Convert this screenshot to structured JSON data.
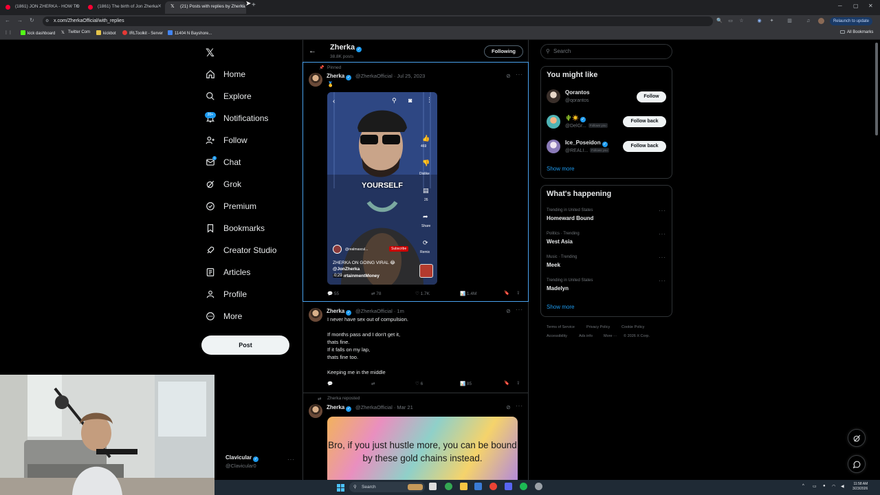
{
  "browser": {
    "tabs": [
      {
        "title": "(1861) JON ZHERKA - HOW TO",
        "favicon": "youtube-icon",
        "active": false
      },
      {
        "title": "(1861) The birth of Jon Zherka",
        "favicon": "youtube-icon",
        "active": false
      },
      {
        "title": "(21) Posts with replies by Zherka",
        "favicon": "x-icon",
        "active": true
      }
    ],
    "new_tab": "+",
    "url": "x.com/ZherkaOfficial/with_replies",
    "relaunch_label": "Relaunch to update",
    "bookmarks": [
      "kick dashboard",
      "Twitter Com",
      "kickbot",
      "IRLToolkit - Server",
      "11404 N Bayshore..."
    ],
    "all_bookmarks": "All Bookmarks"
  },
  "nav": {
    "items": [
      {
        "label": "Home",
        "icon": "home-icon"
      },
      {
        "label": "Explore",
        "icon": "search-icon"
      },
      {
        "label": "Notifications",
        "icon": "bell-icon"
      },
      {
        "label": "Follow",
        "icon": "person-plus-icon"
      },
      {
        "label": "Chat",
        "icon": "mail-icon"
      },
      {
        "label": "Grok",
        "icon": "grok-icon"
      },
      {
        "label": "Premium",
        "icon": "verified-icon"
      },
      {
        "label": "Bookmarks",
        "icon": "bookmark-icon"
      },
      {
        "label": "Creator Studio",
        "icon": "rocket-icon"
      },
      {
        "label": "Articles",
        "icon": "article-icon"
      },
      {
        "label": "Profile",
        "icon": "person-icon"
      },
      {
        "label": "More",
        "icon": "more-circle-icon"
      }
    ],
    "notifications_badge": "20+",
    "chat_badge": "1",
    "post_button": "Post",
    "account": {
      "name": "Clavicular",
      "handle": "@Clavicular0"
    }
  },
  "profile_header": {
    "name": "Zherka",
    "posts_count": "38.8K posts",
    "following_button": "Following"
  },
  "posts": [
    {
      "label": "Pinned",
      "name": "Zherka",
      "handle": "@ZherkaOfficial",
      "date": "· Jul 25, 2023",
      "text": "🥇",
      "video": {
        "caption_big": "YOURSELF",
        "channel": "@realmascul...",
        "subscribe": "Subscribe",
        "title_line1": "ZHERKA ON GOING VIRAL 😂",
        "title_line2": "@JonZherka",
        "title_line3": "#EntertainmentMoney",
        "duration": "0:29",
        "likes_side": "469",
        "dislike": "Dislike",
        "comments_side": "26",
        "share": "Share",
        "remix": "Remix"
      },
      "replies": "55",
      "reposts": "78",
      "likes": "1.7K",
      "views": "1.4M"
    },
    {
      "name": "Zherka",
      "handle": "@ZherkaOfficial",
      "date": "· 1m",
      "lines": [
        "I never have sex out of compulsion.",
        "",
        "If months pass and I don't get it,",
        "thats fine.",
        "If it falls on my lap,",
        "thats fine too.",
        "",
        "Keeping me in the middle"
      ],
      "replies": "",
      "reposts": "",
      "likes": "6",
      "views": "85"
    },
    {
      "label": "Zherka reposted",
      "name": "Zherka",
      "handle": "@ZherkaOfficial",
      "date": "· Mar 21",
      "meme_text": "Bro, if you just hustle more, you can be bound by these gold chains instead."
    }
  ],
  "search": {
    "placeholder": "Search"
  },
  "you_might_like": {
    "title": "You might like",
    "users": [
      {
        "name": "Qorantos",
        "handle": "@qorantos",
        "button": "Follow",
        "follows_you": ""
      },
      {
        "name": "🌵☀️",
        "handle": "@DelGr...",
        "button": "Follow back",
        "follows_you": "Follows you"
      },
      {
        "name": "Ice_Poseidon",
        "handle": "@REALI...",
        "button": "Follow back",
        "follows_you": "Follows you"
      }
    ],
    "show_more": "Show more"
  },
  "whats_happening": {
    "title": "What's happening",
    "trends": [
      {
        "context": "Trending in United States",
        "name": "Homeward Bound"
      },
      {
        "context": "Politics · Trending",
        "name": "West Asia"
      },
      {
        "context": "Music · Trending",
        "name": "Meek"
      },
      {
        "context": "Trending in United States",
        "name": "Madelyn"
      }
    ],
    "show_more": "Show more"
  },
  "footer": [
    "Terms of Service",
    "Privacy Policy",
    "Cookie Policy",
    "Accessibility",
    "Ads info",
    "More ···",
    "© 2026 X Corp."
  ],
  "taskbar": {
    "search_placeholder": "Search",
    "time": "11:58 AM",
    "date": "3/23/2026"
  },
  "colors": {
    "accent": "#1d9bf0",
    "background": "#000000",
    "border": "#2f3336",
    "pinned_border": "#4aa3ef"
  }
}
